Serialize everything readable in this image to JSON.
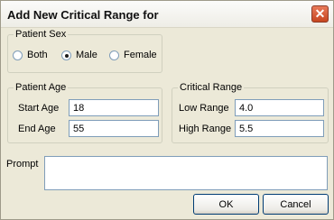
{
  "window": {
    "title": "Add New Critical Range for",
    "close_glyph": "✕"
  },
  "patient_sex": {
    "legend": "Patient Sex",
    "options": [
      {
        "label": "Both",
        "checked": false
      },
      {
        "label": "Male",
        "checked": true
      },
      {
        "label": "Female",
        "checked": false
      }
    ]
  },
  "patient_age": {
    "legend": "Patient Age",
    "start_label": "Start Age",
    "start_value": "18",
    "end_label": "End Age",
    "end_value": "55"
  },
  "critical_range": {
    "legend": "Critical Range",
    "low_label": "Low Range",
    "low_value": "4.0",
    "high_label": "High Range",
    "high_value": "5.5"
  },
  "prompt": {
    "label": "Prompt",
    "value": ""
  },
  "buttons": {
    "ok": "OK",
    "cancel": "Cancel"
  },
  "colors": {
    "accent_border": "#003c74",
    "group_border": "#d0d0bf",
    "dialog_bg": "#ece9d8",
    "close_red": "#c6451f"
  },
  "icons": {
    "close": "close-icon",
    "radio": "radio-button"
  }
}
